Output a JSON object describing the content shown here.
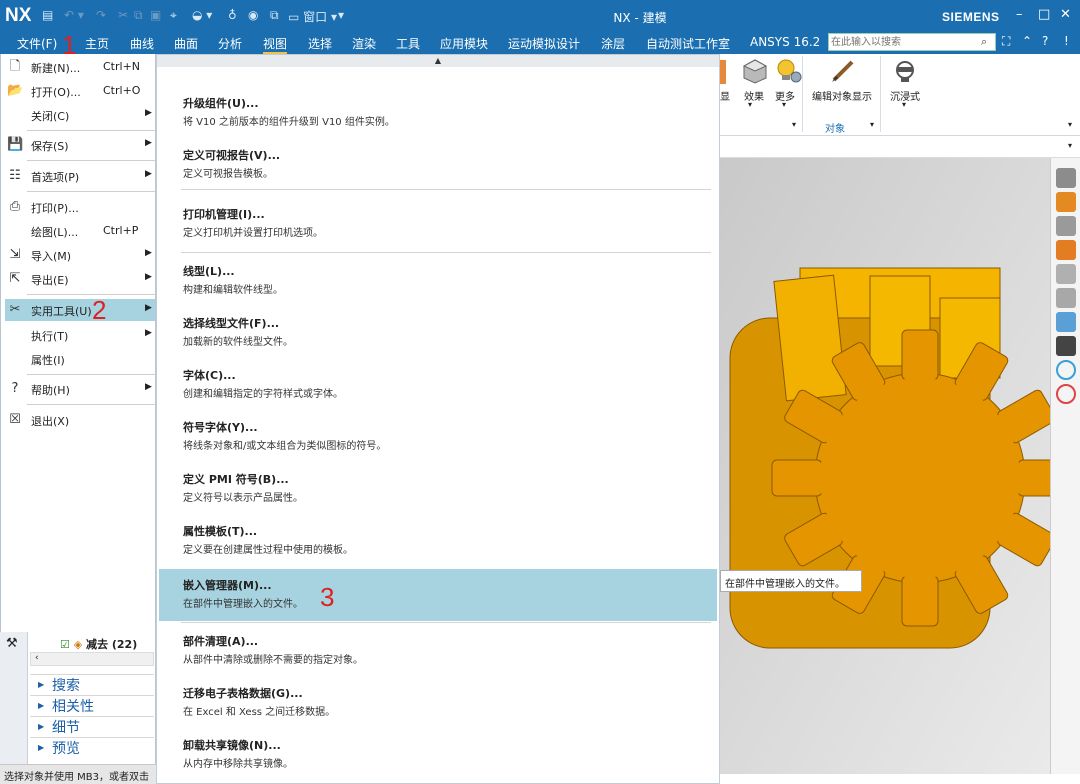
{
  "app": {
    "logo": "NX",
    "title": "NX - 建模",
    "brand": "SIEMENS"
  },
  "window": {
    "minimize": "–",
    "maximize": "□",
    "close": "✕"
  },
  "menubar": {
    "items": [
      "文件(F)",
      "主页",
      "曲线",
      "曲面",
      "分析",
      "视图",
      "选择",
      "渲染",
      "工具",
      "应用模块",
      "运动模拟设计",
      "涂层",
      "自动测试工作室",
      "ANSYS 16.2"
    ],
    "search_placeholder": "在此输入以搜索",
    "right_icons": [
      "⛶",
      "⌃",
      "?",
      "!"
    ]
  },
  "ribbon": {
    "buttons": [
      {
        "label": "效果"
      },
      {
        "label": "更多"
      },
      {
        "label": "编辑对象显示"
      },
      {
        "label": "沉浸式"
      }
    ],
    "partial_label": "显",
    "group_label": "对象"
  },
  "filemenu": {
    "items": [
      {
        "label": "新建(N)...",
        "shortcut": "Ctrl+N",
        "icon": "new-file-icon"
      },
      {
        "label": "打开(O)...",
        "shortcut": "Ctrl+O",
        "icon": "open-folder-icon"
      },
      {
        "label": "关闭(C)",
        "arrow": "▶"
      },
      {
        "label": "保存(S)",
        "arrow": "▶",
        "icon": "save-icon"
      },
      {
        "label": "首选项(P)",
        "arrow": "▶",
        "icon": "preferences-icon"
      },
      {
        "label": "打印(P)...",
        "icon": "print-icon"
      },
      {
        "label": "绘图(L)...",
        "shortcut": "Ctrl+P"
      },
      {
        "label": "导入(M)",
        "arrow": "▶",
        "icon": "import-icon"
      },
      {
        "label": "导出(E)",
        "arrow": "▶",
        "icon": "export-icon"
      },
      {
        "label": "实用工具(U)",
        "arrow": "▶",
        "icon": "utilities-icon"
      },
      {
        "label": "执行(T)",
        "arrow": "▶"
      },
      {
        "label": "属性(I)"
      },
      {
        "label": "帮助(H)",
        "arrow": "▶",
        "icon": "help-icon"
      },
      {
        "label": "退出(X)",
        "icon": "exit-icon"
      }
    ]
  },
  "submenu": {
    "items": [
      {
        "title": "升级组件(U)...",
        "desc": "将 V10 之前版本的组件升级到 V10 组件实例。"
      },
      {
        "title": "定义可视报告(V)...",
        "desc": "定义可视报告模板。"
      },
      {
        "title": "打印机管理(I)...",
        "desc": "定义打印机并设置打印机选项。"
      },
      {
        "title": "线型(L)...",
        "desc": "构建和编辑软件线型。"
      },
      {
        "title": "选择线型文件(F)...",
        "desc": "加载新的软件线型文件。"
      },
      {
        "title": "字体(C)...",
        "desc": "创建和编辑指定的字符样式或字体。"
      },
      {
        "title": "符号字体(Y)...",
        "desc": "将线条对象和/或文本组合为类似图标的符号。"
      },
      {
        "title": "定义 PMI 符号(B)...",
        "desc": "定义符号以表示产品属性。"
      },
      {
        "title": "属性模板(T)...",
        "desc": "定义要在创建属性过程中使用的模板。"
      },
      {
        "title": "嵌入管理器(M)...",
        "desc": "在部件中管理嵌入的文件。"
      },
      {
        "title": "部件清理(A)...",
        "desc": "从部件中清除或删除不需要的指定对象。"
      },
      {
        "title": "迁移电子表格数据(G)...",
        "desc": "在 Excel 和 Xess 之间迁移数据。"
      },
      {
        "title": "卸载共享镜像(N)...",
        "desc": "从内存中移除共享镜像。"
      }
    ]
  },
  "tooltip": "在部件中管理嵌入的文件。",
  "annotations": [
    "1",
    "2",
    "3"
  ],
  "panel": {
    "tree_item": "减去 (22)",
    "sections": [
      "搜索",
      "相关性",
      "细节",
      "预览"
    ]
  },
  "status": "选择对象并使用 MB3，或者双击"
}
